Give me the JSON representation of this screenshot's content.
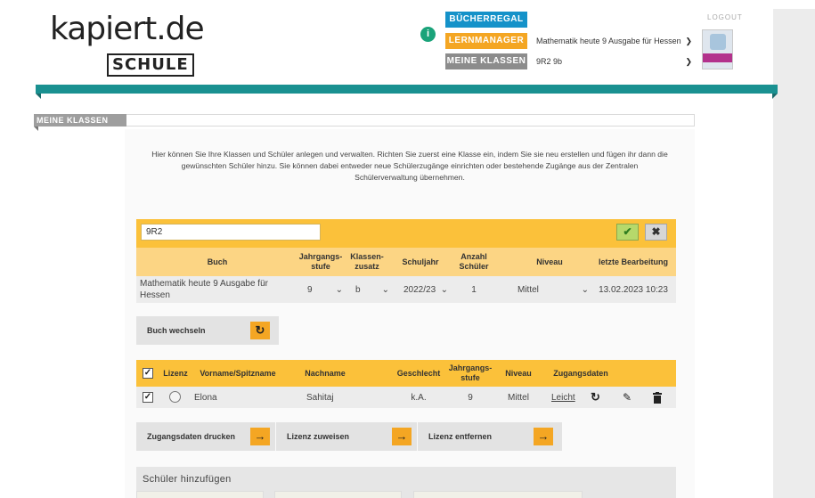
{
  "header": {
    "logo_word": "kapiert.de",
    "logo_sub": "SCHULE",
    "info_icon": "i",
    "logout": "LOGOUT",
    "nav": [
      {
        "label": "BÜCHERREGAL"
      },
      {
        "label": "LERNMANAGER",
        "value": "Mathematik heute 9 Ausgabe für Hessen"
      },
      {
        "label": "MEINE KLASSEN",
        "value": "9R2 9b"
      }
    ]
  },
  "section": {
    "title": "MEINE KLASSEN",
    "intro": "Hier können Sie Ihre Klassen und Schüler anlegen und verwalten. Richten Sie zuerst eine Klasse ein, indem Sie sie neu erstellen und fügen ihr dann die gewünschten Schüler hinzu. Sie können dabei entweder neue Schülerzugänge einrichten oder bestehende Zugänge aus der Zentralen Schülerverwaltung übernehmen."
  },
  "class_form": {
    "class_name": "9R2",
    "confirm_icon": "✔",
    "cancel_icon": "✖",
    "columns": [
      "Buch",
      "Jahrgangs-\nstufe",
      "Klassen-\nzusatz",
      "Schuljahr",
      "Anzahl\nSchüler",
      "Niveau",
      "letzte Bearbeitung"
    ],
    "row": {
      "book": "Mathematik heute 9 Ausgabe für Hessen",
      "grade": "9",
      "suffix": "b",
      "school_year": "2022/23",
      "student_count": "1",
      "level": "Mittel",
      "last_edit": "13.02.2023 10:23"
    },
    "change_book_label": "Buch wechseln",
    "change_book_icon": "↻"
  },
  "students": {
    "columns": [
      "Lizenz",
      "Vorname/Spitzname",
      "Nachname",
      "Geschlecht",
      "Jahrgangs-\nstufe",
      "Niveau",
      "Zugangsdaten"
    ],
    "rows": [
      {
        "first": "Elona",
        "last": "Sahitaj",
        "gender": "k.A.",
        "grade": "9",
        "level": "Mittel",
        "access": "Leicht"
      }
    ],
    "actions": [
      {
        "label": "Zugangsdaten drucken",
        "icon": "→"
      },
      {
        "label": "Lizenz zuweisen",
        "icon": "→"
      },
      {
        "label": "Lizenz entfernen",
        "icon": "→"
      }
    ],
    "add_title": "Schüler hinzufügen"
  },
  "colors": {
    "teal": "#1a9191",
    "orange": "#fbc13a",
    "blue": "#1592c9",
    "grey": "#8c8c8c"
  }
}
